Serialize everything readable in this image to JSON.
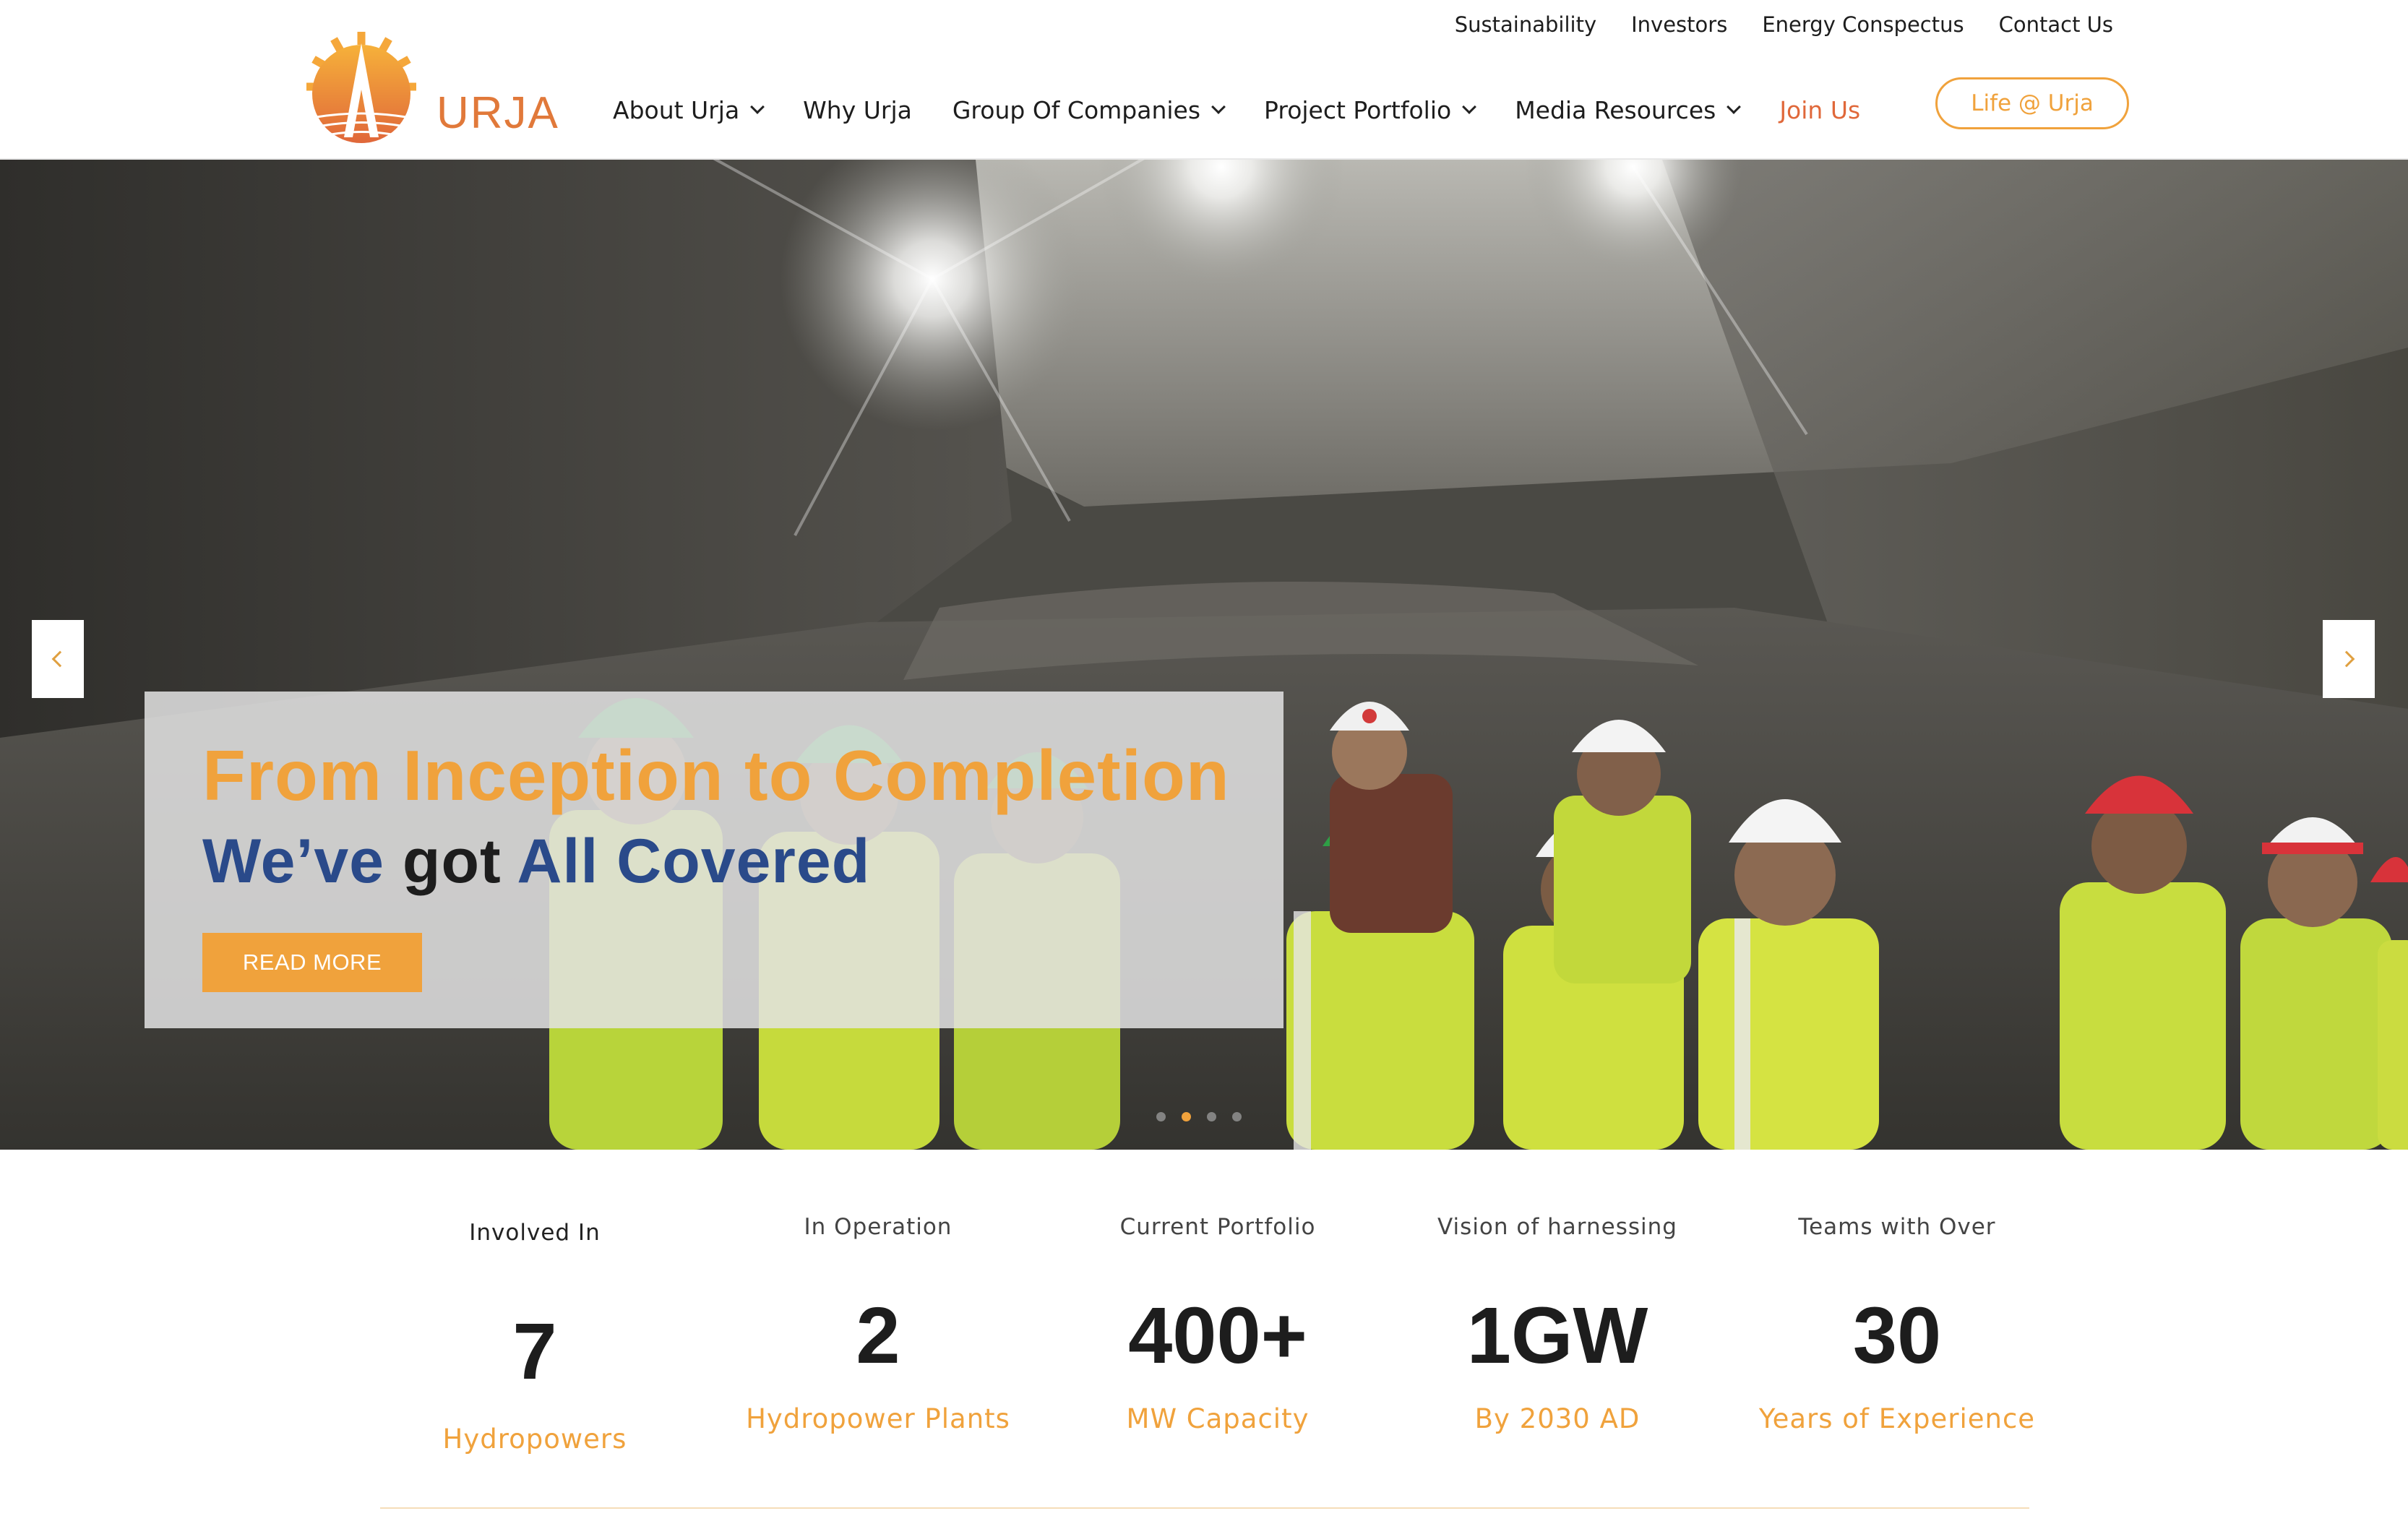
{
  "brand": {
    "name": "URJA"
  },
  "utility_nav": [
    "Sustainability",
    "Investors",
    "Energy Conspectus",
    "Contact Us"
  ],
  "main_nav": [
    {
      "label": "About Urja",
      "dropdown": true
    },
    {
      "label": "Why Urja",
      "dropdown": false
    },
    {
      "label": "Group Of Companies",
      "dropdown": true
    },
    {
      "label": "Project Portfolio",
      "dropdown": true
    },
    {
      "label": "Media Resources",
      "dropdown": true
    },
    {
      "label": "Join Us",
      "dropdown": false
    }
  ],
  "life_button": "Life @ Urja",
  "hero": {
    "headline": "From Inception to Completion",
    "tagline_part1": "We’ve",
    "tagline_part2": "got",
    "tagline_part3": "All Covered",
    "cta": "READ MORE",
    "slide_count": 4,
    "active_slide": 2
  },
  "stats": [
    {
      "label": "Involved In",
      "value": "7",
      "sub": "Hydropowers"
    },
    {
      "label": "In Operation",
      "value": "2",
      "sub": "Hydropower Plants"
    },
    {
      "label": "Current Portfolio",
      "value": "400+",
      "sub": "MW Capacity"
    },
    {
      "label": "Vision of harnessing",
      "value": "1GW",
      "sub": "By 2030 AD"
    },
    {
      "label": "Teams with Over",
      "value": "30",
      "sub": "Years of Experience"
    }
  ],
  "colors": {
    "accent_orange": "#f0a23c",
    "logo_orange": "#e1793a",
    "join_us": "#e0683a",
    "tagline_blue": "#2a4a8a",
    "text_dark": "#1d1d1d"
  },
  "icons": [
    "urja-logo-icon",
    "chevron-down-icon",
    "chevron-left-icon",
    "chevron-right-icon"
  ]
}
